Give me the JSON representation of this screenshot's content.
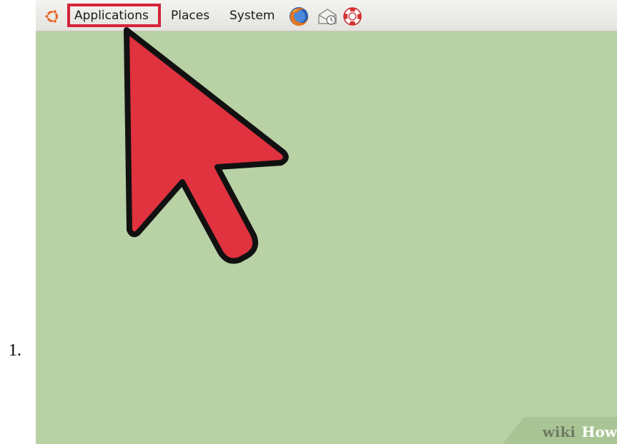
{
  "step": {
    "number": "1."
  },
  "panel": {
    "menus": [
      {
        "label": "Applications",
        "highlighted": true
      },
      {
        "label": "Places"
      },
      {
        "label": "System"
      }
    ],
    "launchers": [
      {
        "icon": "firefox-icon"
      },
      {
        "icon": "mail-icon"
      },
      {
        "icon": "help-icon"
      }
    ]
  },
  "colors": {
    "desktop_background": "#b8d1a5",
    "highlight": "#d5233a",
    "pointer_fill": "#e0323f"
  },
  "watermark": {
    "wiki": "wiki",
    "how": "How"
  }
}
